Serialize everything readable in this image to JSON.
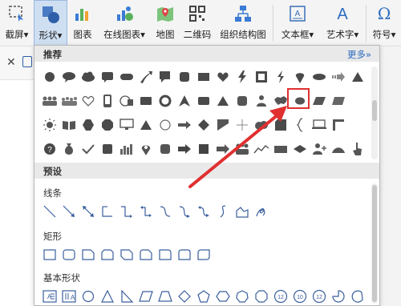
{
  "toolbar": {
    "items": [
      {
        "label": "截屏▾",
        "icon": "screenshot-icon"
      },
      {
        "label": "形状▾",
        "icon": "shapes-icon",
        "active": true
      },
      {
        "label": "图表",
        "icon": "chart-icon"
      },
      {
        "label": "在线图表▾",
        "icon": "online-chart-icon"
      },
      {
        "label": "地图",
        "icon": "map-icon"
      },
      {
        "label": "二维码",
        "icon": "qrcode-icon"
      },
      {
        "label": "组织结构图",
        "icon": "org-chart-icon"
      },
      {
        "label": "文本框▾",
        "icon": "textbox-icon"
      },
      {
        "label": "艺术字▾",
        "icon": "wordart-icon"
      },
      {
        "label": "符号▾",
        "icon": "symbol-icon"
      }
    ]
  },
  "panel": {
    "recommended_title": "推荐",
    "more_label": "更多»",
    "presets_title": "预设",
    "categories": [
      "线条",
      "矩形",
      "基本形状"
    ],
    "basic_shape_labels": [
      "12",
      "10",
      "12"
    ]
  },
  "colors": {
    "accent": "#2d6cc0",
    "shape_dark": "#4a4a4a",
    "outline_blue": "#3a5f9e",
    "arrow_red": "#e03030"
  }
}
